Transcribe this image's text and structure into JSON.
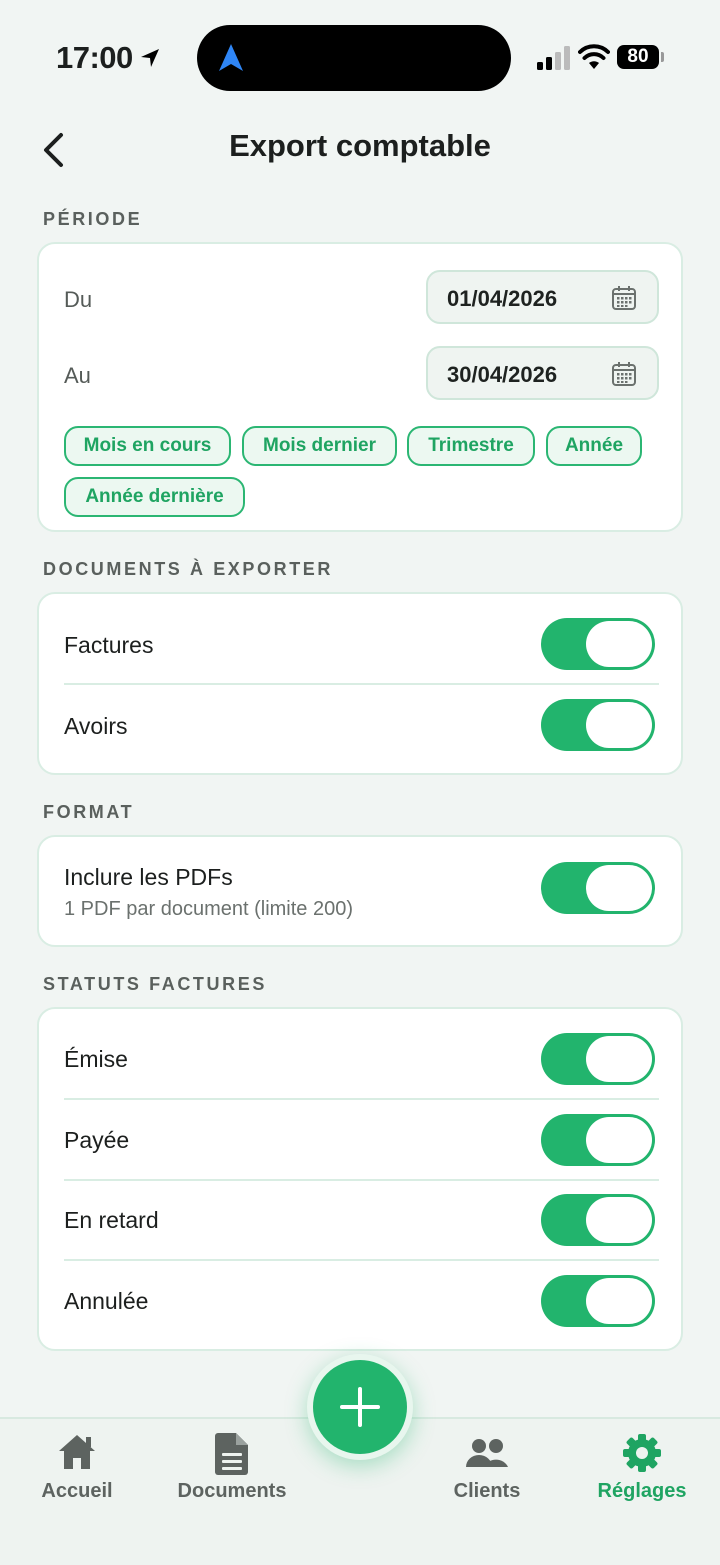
{
  "status": {
    "time": "17:00",
    "battery": "80"
  },
  "header": {
    "title": "Export comptable"
  },
  "periode": {
    "section": "PÉRIODE",
    "from_label": "Du",
    "from_value": "01/04/2026",
    "to_label": "Au",
    "to_value": "30/04/2026",
    "chips": [
      "Mois en cours",
      "Mois dernier",
      "Trimestre",
      "Année",
      "Année dernière"
    ]
  },
  "documents": {
    "section": "DOCUMENTS À EXPORTER",
    "items": [
      {
        "label": "Factures",
        "enabled": true
      },
      {
        "label": "Avoirs",
        "enabled": true
      }
    ]
  },
  "format": {
    "section": "FORMAT",
    "label": "Inclure les PDFs",
    "sub": "1 PDF par document (limite 200)",
    "enabled": true
  },
  "statuts": {
    "section": "STATUTS FACTURES",
    "items": [
      {
        "label": "Émise",
        "enabled": true
      },
      {
        "label": "Payée",
        "enabled": true
      },
      {
        "label": "En retard",
        "enabled": true
      },
      {
        "label": "Annulée",
        "enabled": true
      }
    ]
  },
  "tabs": [
    {
      "label": "Accueil",
      "icon": "home-icon",
      "active": false
    },
    {
      "label": "Documents",
      "icon": "document-icon",
      "active": false
    },
    {
      "label": "Clients",
      "icon": "people-icon",
      "active": false
    },
    {
      "label": "Réglages",
      "icon": "gear-icon",
      "active": true
    }
  ],
  "colors": {
    "accent": "#22b46d",
    "background": "#f1f5f3",
    "card_border": "#d9ede3"
  }
}
